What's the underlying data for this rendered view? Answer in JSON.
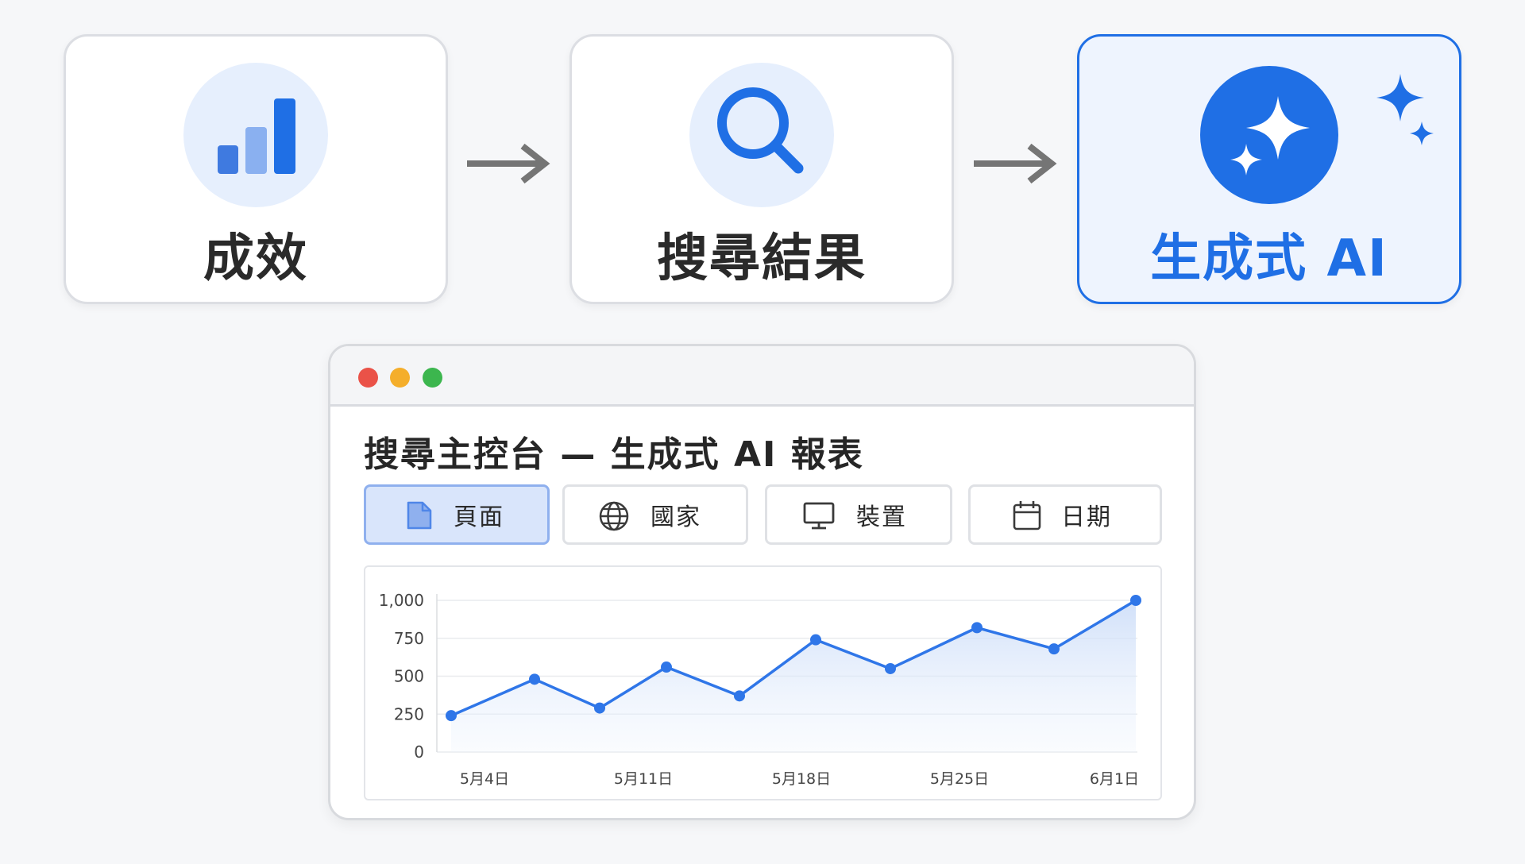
{
  "steps": [
    {
      "label": "成效",
      "icon": "bar-chart-icon",
      "active": false
    },
    {
      "label": "搜尋結果",
      "icon": "search-icon",
      "active": false
    },
    {
      "label": "生成式 AI",
      "icon": "sparkle-icon",
      "active": true
    }
  ],
  "colors": {
    "accent": "#1f6fe5",
    "bar_dark": "#3f7ae0",
    "bar_light": "#8ab0f0",
    "card_border": "#dcdee3",
    "text": "#262626",
    "dot_red": "#ea5248",
    "dot_yellow": "#f4ae2b",
    "dot_green": "#3cb64e"
  },
  "window": {
    "title": "搜尋主控台 — 生成式 AI 報表",
    "tabs": [
      {
        "label": "頁面",
        "icon": "page-icon",
        "selected": true
      },
      {
        "label": "國家",
        "icon": "globe-icon",
        "selected": false
      },
      {
        "label": "裝置",
        "icon": "monitor-icon",
        "selected": false
      },
      {
        "label": "日期",
        "icon": "calendar-icon",
        "selected": false
      }
    ]
  },
  "chart_data": {
    "type": "area",
    "title": "",
    "xlabel": "",
    "ylabel": "",
    "ylim": [
      0,
      1000
    ],
    "y_ticks": [
      "0",
      "250",
      "500",
      "750",
      "1,000"
    ],
    "x_ticks": [
      "5月4日",
      "5月11日",
      "5月18日",
      "5月25日",
      "6月1日"
    ],
    "grid": true,
    "series": [
      {
        "values": [
          240,
          480,
          290,
          560,
          370,
          740,
          550,
          820,
          680,
          1000
        ]
      }
    ]
  }
}
